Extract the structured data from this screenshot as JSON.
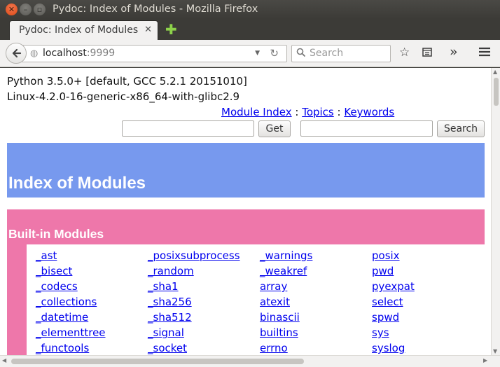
{
  "window": {
    "title": "Pydoc: Index of Modules - Mozilla Firefox"
  },
  "tab": {
    "label": "Pydoc: Index of Modules",
    "close_glyph": "✕",
    "new_tab_glyph": "✚"
  },
  "navbar": {
    "url_host": "localhost",
    "url_port": ":9999",
    "search_placeholder": "Search",
    "icons": [
      "back-arrow-icon",
      "globe-icon",
      "dropdown-icon",
      "reload-icon",
      "search-icon",
      "bookmark-star-icon",
      "reading-list-icon",
      "overflow-chevron-icon",
      "hamburger-menu-icon"
    ]
  },
  "page": {
    "python_version": "Python 3.5.0+ [default, GCC 5.2.1 20151010]",
    "platform": "Linux-4.2.0-16-generic-x86_64-with-glibc2.9",
    "links": {
      "module_index": "Module Index",
      "sep1": " : ",
      "topics": "Topics",
      "sep2": " : ",
      "keywords": "Keywords"
    },
    "get_button": "Get",
    "search_button": "Search",
    "index_title": "Index of Modules",
    "builtin_heading": "Built-in Modules",
    "modules": [
      "_ast",
      "_posixsubprocess",
      "_warnings",
      "posix",
      "_bisect",
      "_random",
      "_weakref",
      "pwd",
      "_codecs",
      "_sha1",
      "array",
      "pyexpat",
      "_collections",
      "_sha256",
      "atexit",
      "select",
      "_datetime",
      "_sha512",
      "binascii",
      "spwd",
      "_elementtree",
      "_signal",
      "builtins",
      "sys",
      "_functools",
      "_socket",
      "errno",
      "syslog"
    ]
  },
  "colors": {
    "index_header": "#7799ee",
    "section_header": "#ee77aa",
    "link": "#0000ee"
  }
}
